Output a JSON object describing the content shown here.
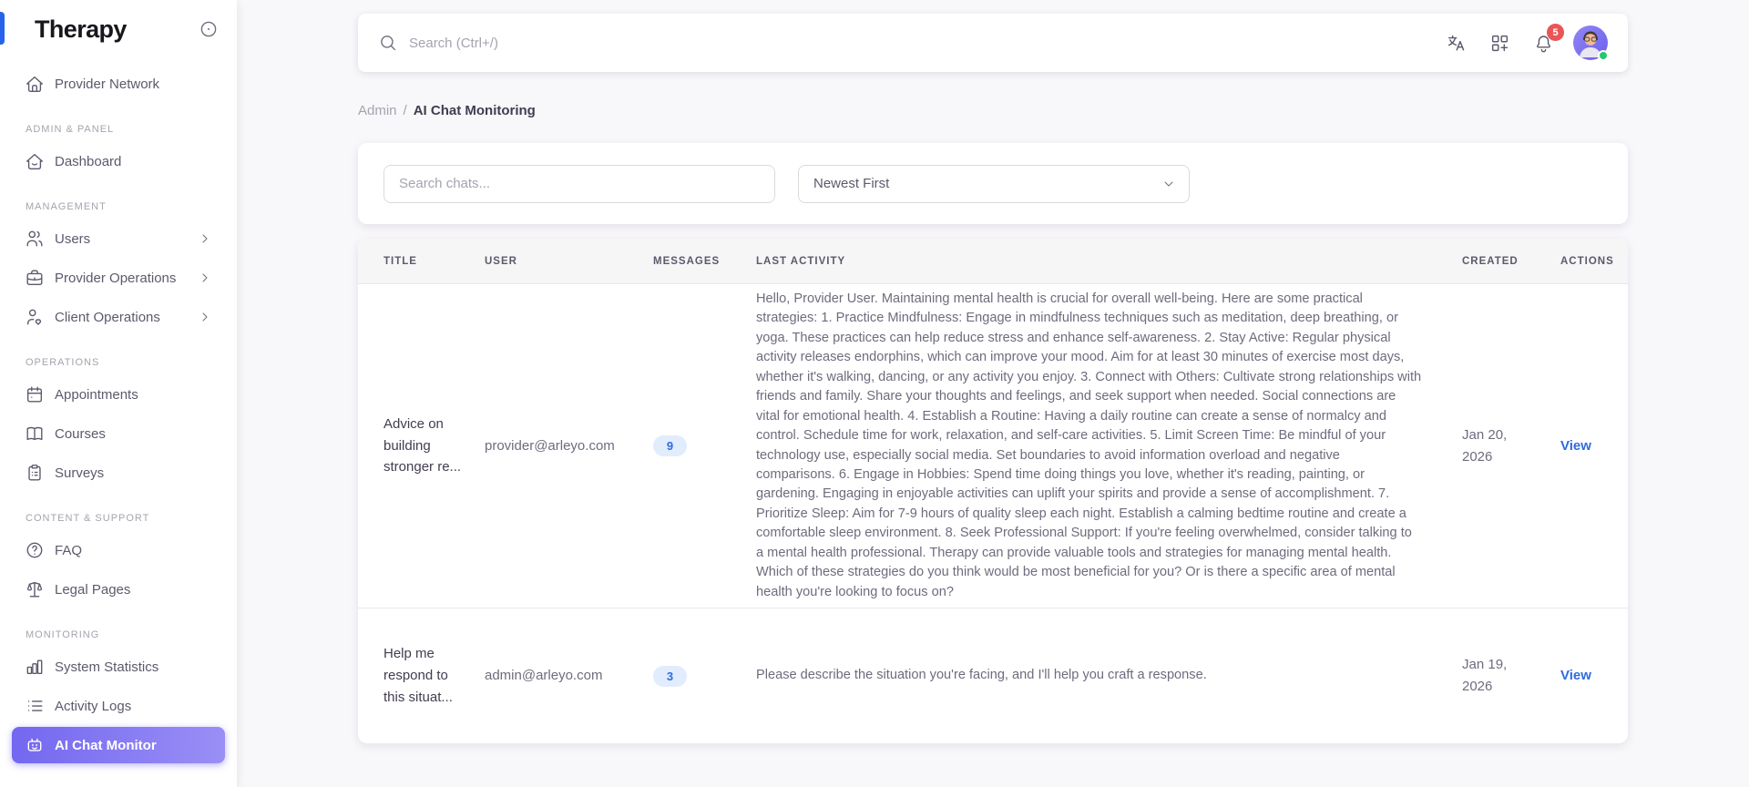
{
  "app": {
    "title": "Therapy"
  },
  "sidebar": {
    "logo_text": "Therapy",
    "sections": [
      {
        "label": "",
        "items": [
          {
            "label": "Provider Network",
            "icon": "home-icon"
          }
        ]
      },
      {
        "label": "ADMIN & PANEL",
        "items": [
          {
            "label": "Dashboard",
            "icon": "home-smile-icon"
          }
        ]
      },
      {
        "label": "MANAGEMENT",
        "items": [
          {
            "label": "Users",
            "icon": "users-icon",
            "expandable": true
          },
          {
            "label": "Provider Operations",
            "icon": "briefcase-icon",
            "expandable": true
          },
          {
            "label": "Client Operations",
            "icon": "user-heart-icon",
            "expandable": true
          }
        ]
      },
      {
        "label": "OPERATIONS",
        "items": [
          {
            "label": "Appointments",
            "icon": "calendar-icon"
          },
          {
            "label": "Courses",
            "icon": "book-icon"
          },
          {
            "label": "Surveys",
            "icon": "clipboard-icon"
          }
        ]
      },
      {
        "label": "CONTENT & SUPPORT",
        "items": [
          {
            "label": "FAQ",
            "icon": "help-circle-icon"
          },
          {
            "label": "Legal Pages",
            "icon": "scales-icon"
          }
        ]
      },
      {
        "label": "MONITORING",
        "items": [
          {
            "label": "System Statistics",
            "icon": "bar-chart-icon"
          },
          {
            "label": "Activity Logs",
            "icon": "list-icon"
          },
          {
            "label": "AI Chat Monitor",
            "icon": "robot-icon",
            "active": true
          }
        ]
      }
    ]
  },
  "topbar": {
    "search_placeholder": "Search (Ctrl+/)",
    "icons": [
      "language-icon",
      "grid-plus-icon",
      "bell-icon"
    ],
    "notification_count": "5",
    "avatar_status": "online"
  },
  "breadcrumb": {
    "parent": "Admin",
    "separator": "/",
    "current": "AI Chat Monitoring"
  },
  "filters": {
    "search_placeholder": "Search chats...",
    "sort_selected": "Newest First"
  },
  "table": {
    "columns": [
      "TITLE",
      "USER",
      "MESSAGES",
      "LAST ACTIVITY",
      "CREATED",
      "ACTIONS"
    ],
    "rows": [
      {
        "title": "Advice on building stronger re...",
        "user": "provider@arleyo.com",
        "messages": "9",
        "last_activity": "Hello, Provider User. Maintaining mental health is crucial for overall well-being. Here are some practical strategies: 1. Practice Mindfulness: Engage in mindfulness techniques such as meditation, deep breathing, or yoga. These practices can help reduce stress and enhance self-awareness. 2. Stay Active: Regular physical activity releases endorphins, which can improve your mood. Aim for at least 30 minutes of exercise most days, whether it's walking, dancing, or any activity you enjoy. 3. Connect with Others: Cultivate strong relationships with friends and family. Share your thoughts and feelings, and seek support when needed. Social connections are vital for emotional health. 4. Establish a Routine: Having a daily routine can create a sense of normalcy and control. Schedule time for work, relaxation, and self-care activities. 5. Limit Screen Time: Be mindful of your technology use, especially social media. Set boundaries to avoid information overload and negative comparisons. 6. Engage in Hobbies: Spend time doing things you love, whether it's reading, painting, or gardening. Engaging in enjoyable activities can uplift your spirits and provide a sense of accomplishment. 7. Prioritize Sleep: Aim for 7-9 hours of quality sleep each night. Establish a calming bedtime routine and create a comfortable sleep environment. 8. Seek Professional Support: If you're feeling overwhelmed, consider talking to a mental health professional. Therapy can provide valuable tools and strategies for managing mental health. Which of these strategies do you think would be most beneficial for you? Or is there a specific area of mental health you're looking to focus on?",
        "created": "Jan 20, 2026",
        "action": "View"
      },
      {
        "title": "Help me respond to this situat...",
        "user": "admin@arleyo.com",
        "messages": "3",
        "last_activity": "Please describe the situation you're facing, and I'll help you craft a response.",
        "created": "Jan 19, 2026",
        "action": "View"
      }
    ]
  },
  "colors": {
    "primary": "#7367f0",
    "link_blue": "#2e6be0",
    "badge_bg": "#e1ecfd",
    "danger": "#ea5455",
    "success": "#28c76f",
    "page_bg": "#f8f7fa",
    "logo_accent": "#2563eb"
  }
}
